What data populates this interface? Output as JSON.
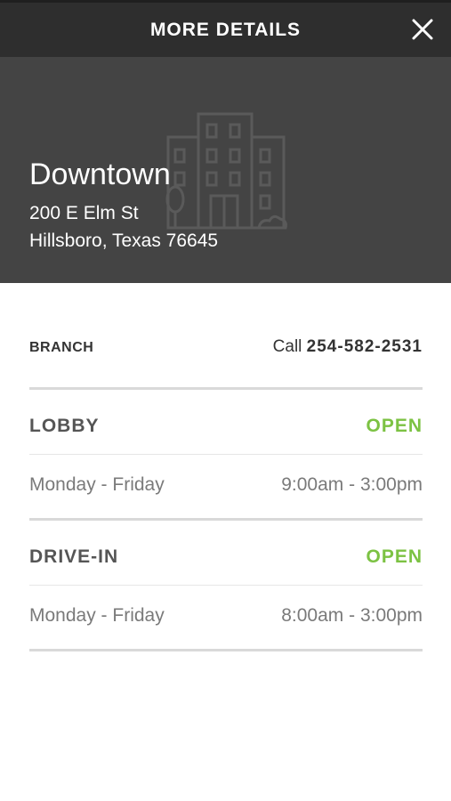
{
  "header": {
    "title": "MORE DETAILS",
    "close_icon": "close-icon"
  },
  "location": {
    "name": "Downtown",
    "address_line1": "200 E Elm St",
    "address_line2": "Hillsboro, Texas 76645",
    "illustration_icon": "building-icon"
  },
  "branch": {
    "label": "BRANCH",
    "call_prefix": "Call",
    "phone": "254-582-2531"
  },
  "sections": [
    {
      "title": "LOBBY",
      "status": "OPEN",
      "days": "Monday - Friday",
      "hours": "9:00am - 3:00pm"
    },
    {
      "title": "DRIVE-IN",
      "status": "OPEN",
      "days": "Monday - Friday",
      "hours": "8:00am - 3:00pm"
    }
  ],
  "colors": {
    "header_bg": "#2e2e2e",
    "hero_bg": "#444444",
    "open_status": "#7cc243"
  }
}
